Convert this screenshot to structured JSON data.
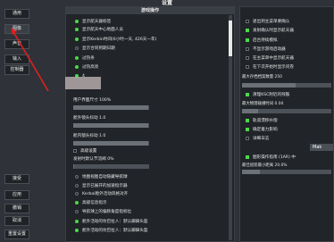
{
  "window": {
    "title": "设置"
  },
  "nav": {
    "top": [
      "通用",
      "图像",
      "声音",
      "输入",
      "控制器"
    ],
    "bottom": [
      "接受",
      "应用",
      "撤销",
      "取消",
      "重置设置"
    ]
  },
  "game_ops": {
    "title": "游戏操作",
    "rows": [
      {
        "label": "显示航天器标签",
        "state": "on"
      },
      {
        "label": "显示航天中心地面人员",
        "state": "on"
      },
      {
        "label": "显示Kerbin时间(6小时一天, 426天一年)",
        "state": "on"
      },
      {
        "label": "显示合同到期日期",
        "state": "off"
      },
      {
        "label": "过热条",
        "state": "on"
      },
      {
        "label": "过热高亮",
        "state": "on"
      }
    ],
    "blur_prefix": "4",
    "ui_scale": {
      "label": "用户界面尺寸 100%",
      "value": 1.0
    },
    "cam_shake_1": {
      "label": "舱外镜头抖动 1.0",
      "value": 1.0
    },
    "cam_shake_2": {
      "label": "舱内镜头抖动 1.0",
      "value": 1.0
    },
    "advanced": {
      "label": "高级设置"
    },
    "launch_shake": {
      "label": "发射时默认节流阀 0%",
      "value": 0.0
    },
    "rows2": [
      {
        "label": "地图视图自动隐藏导航球",
        "state": "off"
      },
      {
        "label": "显示已展开的加速指示器",
        "state": "off"
      },
      {
        "label": "Kerbal舱外活动风格对齐",
        "state": "off"
      },
      {
        "label": "高级信息指示",
        "state": "on"
      },
      {
        "label": "导航球上的偏移角度指标位",
        "state": "off"
      },
      {
        "label": "舱外活动的坎巴拉人：默认脚踩头盔",
        "state": "on"
      },
      {
        "label": "舱外活动的坎巴拉人：默认脚踩头盔",
        "state": "on"
      }
    ],
    "scroll": 0.15
  },
  "side": {
    "rows": [
      {
        "label": "退出到主菜单要确认",
        "state": "off"
      },
      {
        "label": "发射确认时显示航天器",
        "state": "on"
      },
      {
        "label": "后台持续模拟",
        "state": "on"
      },
      {
        "label": "不显示游戏启动器",
        "state": "off"
      },
      {
        "label": "在主菜单中显示航天器",
        "state": "off"
      },
      {
        "label": "在下次开始时显示问卷",
        "state": "off"
      }
    ],
    "stats1": [
      {
        "label": "最大存档档案数量 250",
        "value": ""
      }
    ],
    "rows2": [
      {
        "label": "清理KSC附近的残骸",
        "state": "on"
      }
    ],
    "stats2": [
      {
        "label": "最大物理碰撞时间 0.04",
        "value": ""
      }
    ],
    "rows3": [
      {
        "label": "轨道漂移补偿",
        "state": "on"
      },
      {
        "label": "确定着力影响",
        "state": "on"
      },
      {
        "label": "详细日志",
        "state": "off"
      }
    ],
    "make_label": "Mak",
    "rows4": [
      {
        "label": "图形操作指南 (1AR) 中",
        "state": "on"
      }
    ],
    "stats3": [
      {
        "label": "最准确的组件选择最小距离",
        "value": ""
      },
      {
        "label": "最佳组装最小距离 20.0%",
        "value": ""
      }
    ]
  },
  "colors": {
    "accent_green": "#4cd84c",
    "panel": "#212429",
    "bg": "#2f3238"
  }
}
